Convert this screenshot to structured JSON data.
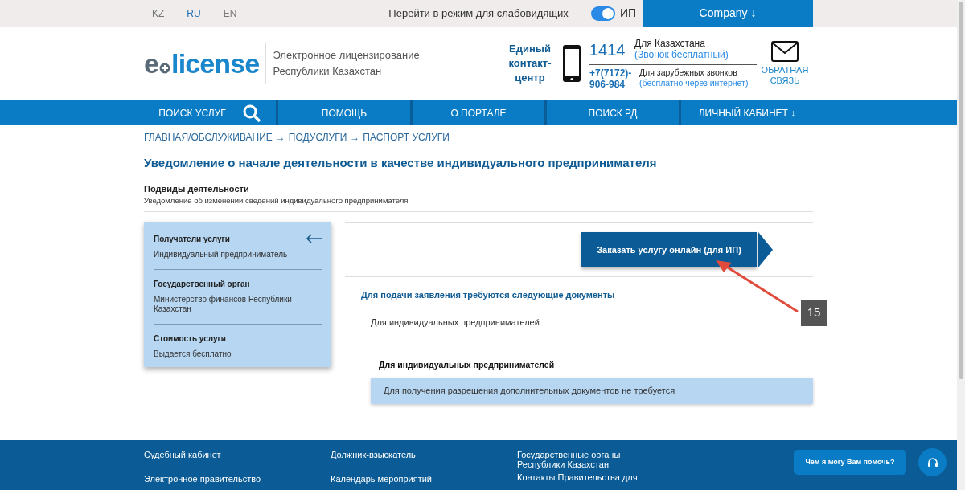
{
  "top_bar": {
    "languages": [
      {
        "label": "KZ",
        "selected": false
      },
      {
        "label": "RU",
        "selected": true
      },
      {
        "label": "EN",
        "selected": false
      }
    ],
    "accessibility_link": "Перейти в режим для слабовидящих",
    "toggle": {
      "on": true,
      "label": "ИП"
    },
    "company_button": "Company ↓"
  },
  "header": {
    "logo": {
      "first": "e",
      "rest": "license"
    },
    "tagline": [
      "Электронное лицензирование",
      "Республики Казахстан"
    ],
    "contact_center": "Единый контакт-центр",
    "phone": "1414",
    "local_label": "Для Казахстана",
    "local_note": "(Звонок бесплатный)",
    "intl_phone": "+7(7172)-906-984",
    "intl_label": "Для зарубежных звонков",
    "intl_note": "(бесплатно через интернет)",
    "feedback": "ОБРАТНАЯ СВЯЗЬ"
  },
  "nav": [
    {
      "label": "ПОИСК УСЛУГ",
      "kind": "search"
    },
    {
      "label": "ПОМОЩЬ",
      "kind": "link"
    },
    {
      "label": "О ПОРТАЛЕ",
      "kind": "link"
    },
    {
      "label": "ПОИСК РД",
      "kind": "link"
    },
    {
      "label": "ЛИЧНЫЙ КАБИНЕТ ↓",
      "kind": "link"
    }
  ],
  "breadcrumb": {
    "items": [
      "ГЛАВНАЯ/ОБСЛУЖИВАНИЕ",
      "ПОДУСЛУГИ",
      "ПАСПОРТ УСЛУГИ"
    ],
    "separator": "→"
  },
  "title": "Уведомление о начале деятельности в качестве индивидуального предпринимателя",
  "subtypes": {
    "heading": "Подвиды деятельности",
    "text": "Уведомление об изменении сведений индивидуального предпринимателя"
  },
  "sidebar": [
    {
      "heading": "Получатели услуги",
      "value": "Индивидуальный предприниматель"
    },
    {
      "heading": "Государственный орган",
      "value": "Министерство финансов Республики Казахстан"
    },
    {
      "heading": "Стоимость услуги",
      "value": "Выдается бесплатно"
    }
  ],
  "order_button": "Заказать услугу онлайн (для ИП)",
  "documents": {
    "heading": "Для подачи заявления требуются следующие документы",
    "link": "Для индивидуальных предпринимателей",
    "group_title": "Для индивидуальных предпринимателей",
    "note": "Для получения разрешения дополнительных документов не требуется"
  },
  "annotation": "15",
  "footer": [
    [
      "Судебный кабинет",
      "Электронное правительство"
    ],
    [
      "Должник-взыскатель",
      "Календарь мероприятий"
    ],
    [
      "Государственные органы Республики Казахстан",
      "Контакты Правительства для"
    ]
  ],
  "chat": "Чем я могу Вам помочь?"
}
